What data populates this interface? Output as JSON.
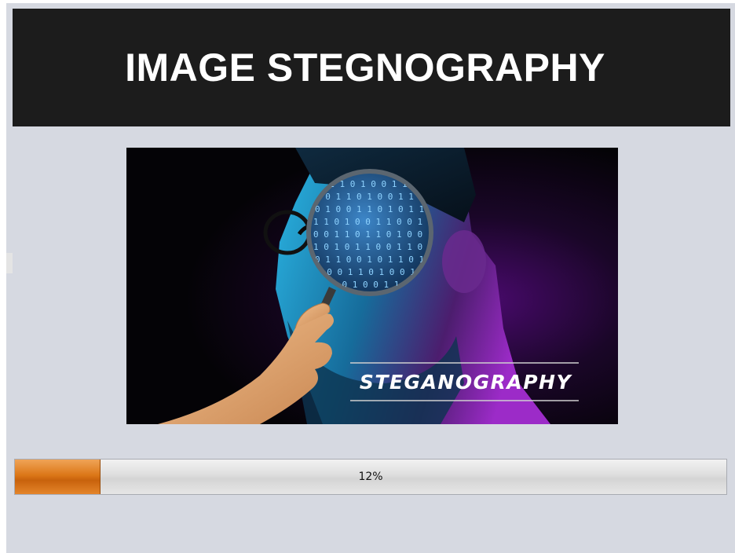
{
  "header": {
    "title": "IMAGE STEGNOGRAPHY"
  },
  "hero_image": {
    "overlay_text": "STEGANOGRAPHY",
    "description_icon": "magnifying-glass-icon"
  },
  "progress": {
    "value": 0.12,
    "label": "12%"
  },
  "colors": {
    "window_bg": "#d6d9e1",
    "banner_bg": "#1c1c1c",
    "banner_text": "#ffffff",
    "progress_fill": "#dc7718"
  }
}
